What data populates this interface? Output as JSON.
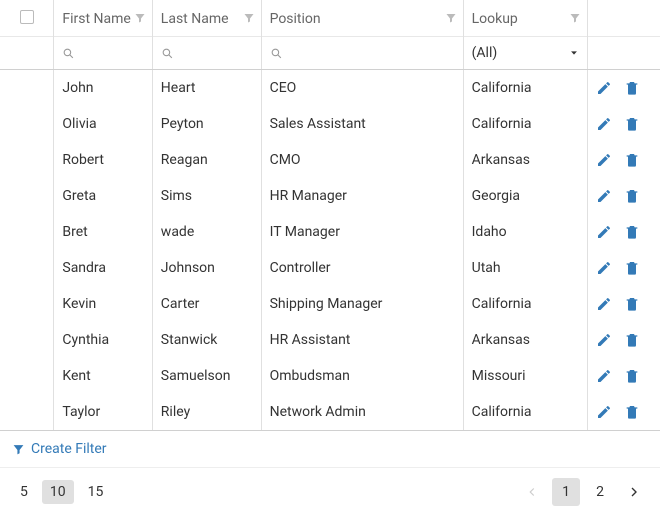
{
  "columns": {
    "first": "First Name",
    "last": "Last Name",
    "position": "Position",
    "lookup": "Lookup"
  },
  "filterRow": {
    "lookupAll": "(All)"
  },
  "rows": [
    {
      "first": "John",
      "last": "Heart",
      "position": "CEO",
      "lookup": "California"
    },
    {
      "first": "Olivia",
      "last": "Peyton",
      "position": "Sales Assistant",
      "lookup": "California"
    },
    {
      "first": "Robert",
      "last": "Reagan",
      "position": "CMO",
      "lookup": "Arkansas"
    },
    {
      "first": "Greta",
      "last": "Sims",
      "position": "HR Manager",
      "lookup": "Georgia"
    },
    {
      "first": "Bret",
      "last": "wade",
      "position": "IT Manager",
      "lookup": "Idaho"
    },
    {
      "first": "Sandra",
      "last": "Johnson",
      "position": "Controller",
      "lookup": "Utah"
    },
    {
      "first": "Kevin",
      "last": "Carter",
      "position": "Shipping Manager",
      "lookup": "California"
    },
    {
      "first": "Cynthia",
      "last": "Stanwick",
      "position": "HR Assistant",
      "lookup": "Arkansas"
    },
    {
      "first": "Kent",
      "last": "Samuelson",
      "position": "Ombudsman",
      "lookup": "Missouri"
    },
    {
      "first": "Taylor",
      "last": "Riley",
      "position": "Network Admin",
      "lookup": "California"
    }
  ],
  "footer": {
    "createFilter": "Create Filter"
  },
  "pager": {
    "sizes": [
      "5",
      "10",
      "15"
    ],
    "activeSize": "10",
    "pages": [
      "1",
      "2"
    ],
    "activePage": "1"
  },
  "colors": {
    "accent": "#337ab7"
  }
}
